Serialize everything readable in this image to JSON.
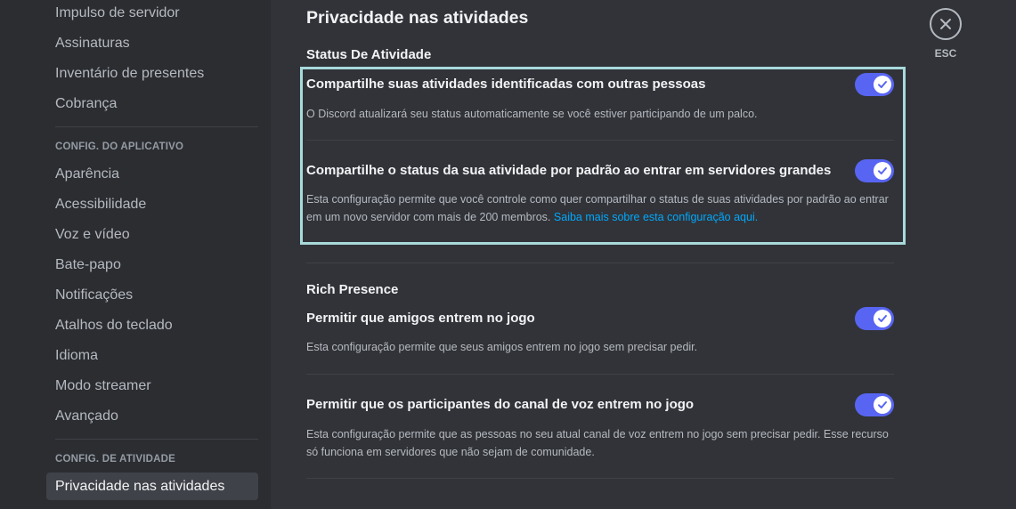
{
  "sidebar": {
    "items_top": [
      "Impulso de servidor",
      "Assinaturas",
      "Inventário de presentes",
      "Cobrança"
    ],
    "app_header": "CONFIG. DO APLICATIVO",
    "app_items": [
      "Aparência",
      "Acessibilidade",
      "Voz e vídeo",
      "Bate-papo",
      "Notificações",
      "Atalhos do teclado",
      "Idioma",
      "Modo streamer",
      "Avançado"
    ],
    "activity_header": "CONFIG. DE ATIVIDADE",
    "activity_items": [
      "Privacidade nas atividades"
    ]
  },
  "main": {
    "page_title": "Privacidade nas atividades",
    "activity_status": {
      "section_title": "Status De Atividade",
      "settings": [
        {
          "title": "Compartilhe suas atividades identificadas com outras pessoas",
          "description": "O Discord atualizará seu status automaticamente se você estiver participando de um palco.",
          "enabled": true
        },
        {
          "title": "Compartilhe o status da sua atividade por padrão ao entrar em servidores grandes",
          "description": "Esta configuração permite que você controle como quer compartilhar o status de suas atividades por padrão ao entrar em um novo servidor com mais de 200 membros.",
          "link": "Saiba mais sobre esta configuração aqui.",
          "enabled": true
        }
      ]
    },
    "rich_presence": {
      "section_title": "Rich Presence",
      "settings": [
        {
          "title": "Permitir que amigos entrem no jogo",
          "description": "Esta configuração permite que seus amigos entrem no jogo sem precisar pedir.",
          "enabled": true
        },
        {
          "title": "Permitir que os participantes do canal de voz entrem no jogo",
          "description": "Esta configuração permite que as pessoas no seu atual canal de voz entrem no jogo sem precisar pedir. Esse recurso só funciona em servidores que não sejam de comunidade.",
          "enabled": true
        }
      ]
    }
  },
  "close": {
    "icon": "close-icon",
    "label": "ESC"
  },
  "colors": {
    "accent": "#5865f2",
    "highlight_border": "#a8dadc",
    "link": "#00a8fc",
    "sidebar_bg": "#2b2d31",
    "content_bg": "#313338"
  }
}
